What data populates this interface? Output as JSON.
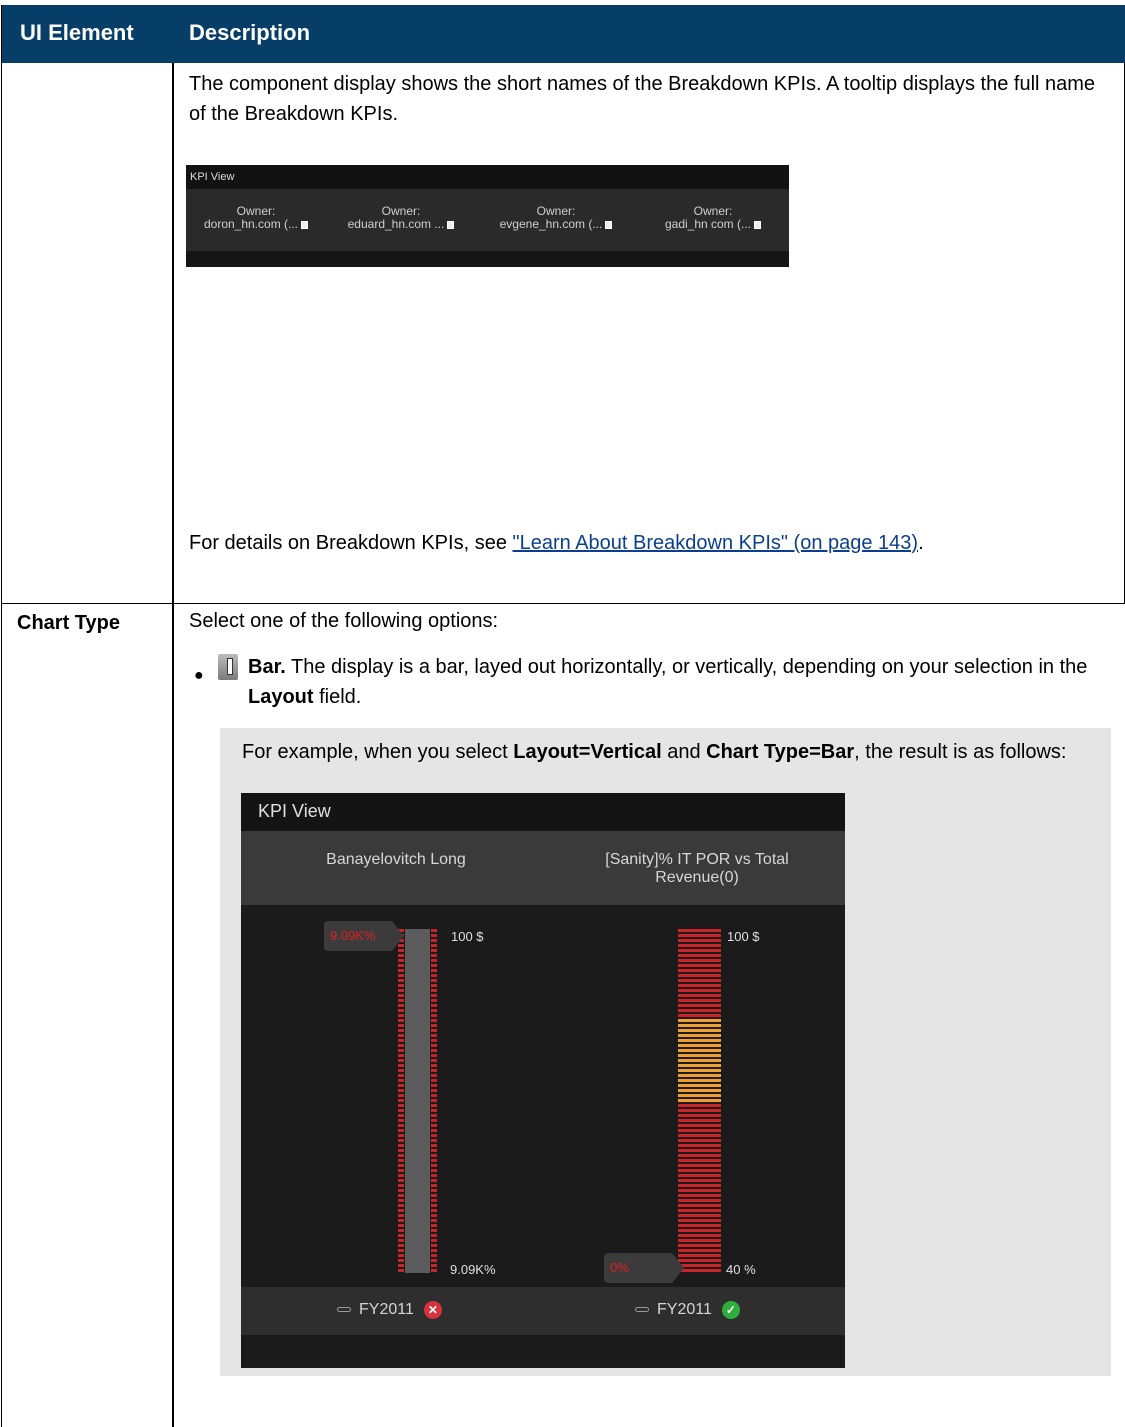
{
  "table": {
    "header": {
      "ui_element": "UI Element",
      "description": "Description"
    },
    "row1": {
      "paragraph": "The component display shows the short names of the Breakdown KPIs. A tooltip displays the full name of the Breakdown KPIs.",
      "details_prefix": "For details on Breakdown KPIs, see ",
      "details_link": "\"Learn About Breakdown KPIs\" (on page 143)",
      "details_suffix": ".",
      "kpi_strip": {
        "title": "KPI View",
        "owners": [
          {
            "label": "Owner:",
            "value": "doron_hn.com (..."
          },
          {
            "label": "Owner:",
            "value": "eduard_hn.com ..."
          },
          {
            "label": "Owner:",
            "value": "evgene_hn.com (..."
          },
          {
            "label": "Owner:",
            "value": "gadi_hn com (..."
          }
        ]
      }
    },
    "row2": {
      "label": "Chart Type",
      "intro": "Select one of the following options:",
      "bullet": {
        "icon": "bar-chart-icon",
        "bold": "Bar.",
        "text1": " The display is a bar, layed out horizontally, or vertically, depending on your selection in the ",
        "bold2": "Layout",
        "text2": " field."
      },
      "example": {
        "t1": "For example, when you select ",
        "b1": "Layout=Vertical",
        "t2": " and ",
        "b2": "Chart Type=Bar",
        "t3": ", the result is as follows:"
      }
    }
  },
  "kpi_view": {
    "title": "KPI View",
    "columns": [
      {
        "title": "Banayelovitch Long",
        "top_label": "100 $",
        "bottom_label": "9.09K%",
        "pointer": "9.09K%",
        "footer": "FY2011",
        "status": "error"
      },
      {
        "title": "[Sanity]% IT POR vs Total Revenue(0)",
        "top_label": "100 $",
        "bottom_label": "40 %",
        "pointer": "0%",
        "footer": "FY2011",
        "status": "ok"
      }
    ],
    "colors": {
      "red": "#c8242a",
      "orange": "#f0a030",
      "gray": "#5c5c5c"
    }
  }
}
